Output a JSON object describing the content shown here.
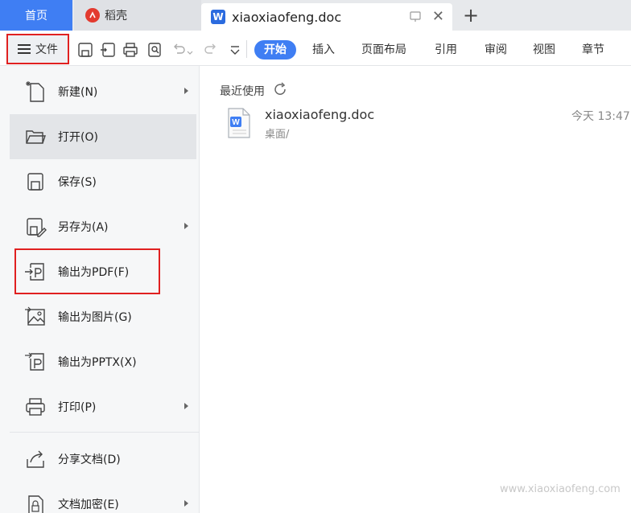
{
  "tabs": {
    "home_label": "首页",
    "daoke_label": "稻壳",
    "doc_label": "xiaoxiaofeng.doc",
    "doc_icon": "word-icon"
  },
  "toolbar": {
    "file_label": "文件",
    "ribbon_tabs": [
      "开始",
      "插入",
      "页面布局",
      "引用",
      "审阅",
      "视图",
      "章节"
    ],
    "active_tab": "开始",
    "accent": "#3f7ef3",
    "highlight": "#e02020"
  },
  "menu": {
    "items": [
      {
        "label": "新建(N)",
        "icon": "new-file-icon",
        "has_submenu": true
      },
      {
        "label": "打开(O)",
        "icon": "folder-open-icon",
        "has_submenu": false,
        "selected": true
      },
      {
        "label": "保存(S)",
        "icon": "save-icon",
        "has_submenu": false
      },
      {
        "label": "另存为(A)",
        "icon": "save-as-icon",
        "has_submenu": true
      },
      {
        "label": "输出为PDF(F)",
        "icon": "export-pdf-icon",
        "has_submenu": false,
        "highlighted": true
      },
      {
        "label": "输出为图片(G)",
        "icon": "export-image-icon",
        "has_submenu": false
      },
      {
        "label": "输出为PPTX(X)",
        "icon": "export-pptx-icon",
        "has_submenu": false
      },
      {
        "label": "打印(P)",
        "icon": "print-icon",
        "has_submenu": true
      },
      {
        "label": "分享文档(D)",
        "icon": "share-icon",
        "has_submenu": false
      },
      {
        "label": "文档加密(E)",
        "icon": "encrypt-icon",
        "has_submenu": true
      }
    ]
  },
  "recent": {
    "title": "最近使用",
    "files": [
      {
        "name": "xiaoxiaofeng.doc",
        "path": "桌面/",
        "time": "今天  13:47"
      }
    ]
  },
  "watermark": "www.xiaoxiaofeng.com"
}
